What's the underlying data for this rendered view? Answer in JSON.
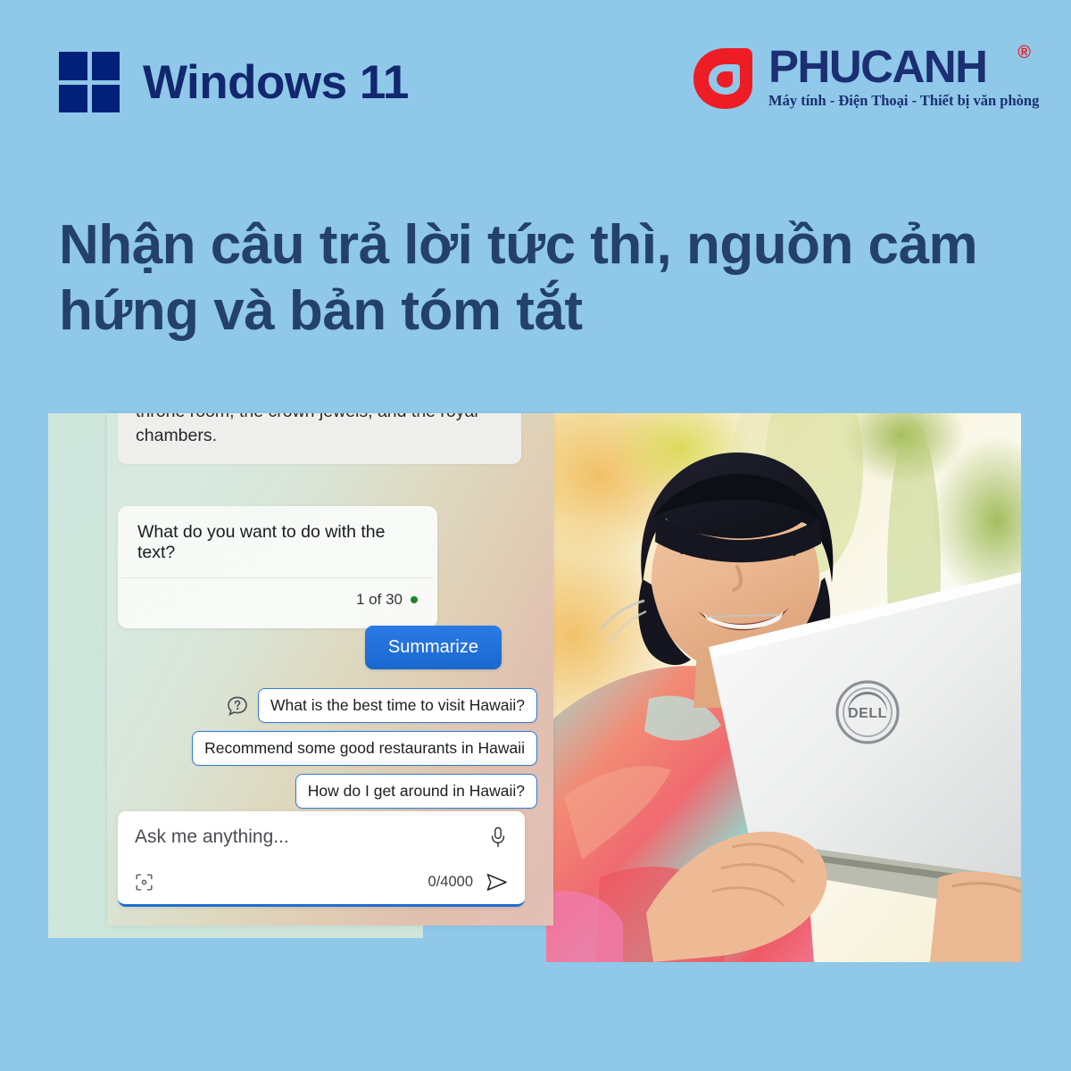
{
  "page": {
    "background_color": "#8fc8e8"
  },
  "header": {
    "windows": {
      "icon": "windows-logo-icon",
      "wordmark": "Windows 11",
      "color": "#11276e"
    },
    "brand": {
      "mark_icon": "phucanh-swirl-icon",
      "name": "PHUCANH",
      "registered": "®",
      "tagline": "Máy tính - Điện Thoại - Thiết bị văn phòng",
      "mark_color": "#ee1c25",
      "text_color": "#1b2f72"
    }
  },
  "headline": {
    "text": "Nhận câu trả lời tức thì, nguồn cảm hứng và bản tóm tắt",
    "color": "#23416b"
  },
  "chat": {
    "ai_message": "palace in the U.S., where you can see the throne room, the crown jewels, and the royal chambers.",
    "prompt_card": {
      "question": "What do you want to do with the text?",
      "counter": "1 of 30",
      "status_dot_color": "#19852f"
    },
    "summarize_label": "Summarize",
    "summarize_color": "#1a68ce",
    "suggestion_icon": "question-bubble-icon",
    "suggestions": [
      "What is the best time to visit Hawaii?",
      "Recommend some good restaurants in Hawaii",
      "How do I get around in Hawaii?"
    ],
    "composer": {
      "placeholder": "Ask me anything...",
      "char_count": "0/4000",
      "mic_icon": "microphone-icon",
      "scan_icon": "scan-capture-icon",
      "send_icon": "send-icon",
      "accent_color": "#1f6ed0"
    }
  },
  "photo": {
    "description": "young-woman-smiling-holding-laptop-outdoors",
    "laptop_brand": "DELL"
  }
}
